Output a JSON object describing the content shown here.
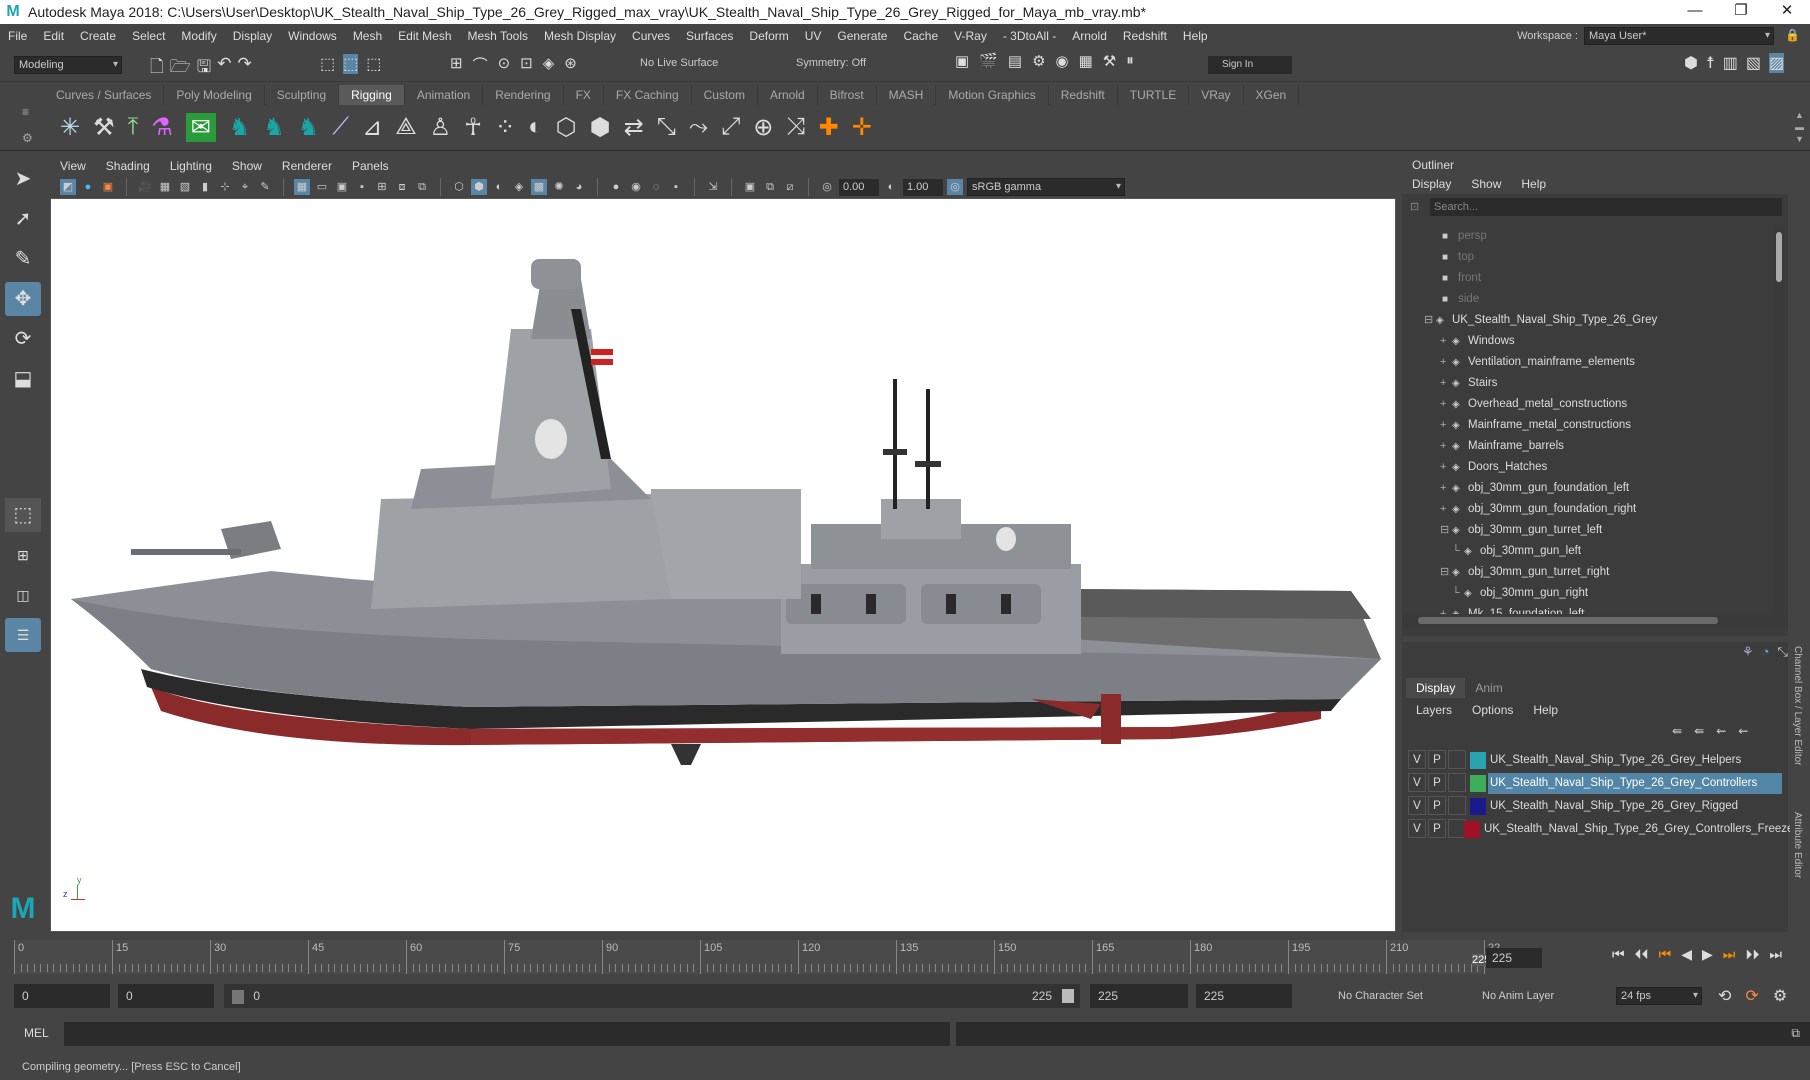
{
  "title": "Autodesk Maya 2018: C:\\Users\\User\\Desktop\\UK_Stealth_Naval_Ship_Type_26_Grey_Rigged_max_vray\\UK_Stealth_Naval_Ship_Type_26_Grey_Rigged_for_Maya_mb_vray.mb*",
  "menus": [
    "File",
    "Edit",
    "Create",
    "Select",
    "Modify",
    "Display",
    "Windows",
    "Mesh",
    "Edit Mesh",
    "Mesh Tools",
    "Mesh Display",
    "Curves",
    "Surfaces",
    "Deform",
    "UV",
    "Generate",
    "Cache",
    "V-Ray",
    "- 3DtoAll -",
    "Arnold",
    "Redshift",
    "Help"
  ],
  "workspace": {
    "label": "Workspace :",
    "value": "Maya User*"
  },
  "status": {
    "mode": "Modeling",
    "live_surface": "No Live Surface",
    "symmetry": "Symmetry: Off",
    "sign_in": "Sign In"
  },
  "shelf_tabs": [
    "Curves / Surfaces",
    "Poly Modeling",
    "Sculpting",
    "Rigging",
    "Animation",
    "Rendering",
    "FX",
    "FX Caching",
    "Custom",
    "Arnold",
    "Bifrost",
    "MASH",
    "Motion Graphics",
    "Redshift",
    "TURTLE",
    "VRay",
    "XGen"
  ],
  "active_shelf": "Rigging",
  "viewport_menu": [
    "View",
    "Shading",
    "Lighting",
    "Show",
    "Renderer",
    "Panels"
  ],
  "viewport_fields": {
    "exposure": "0.00",
    "gamma": "1.00",
    "colorspace": "sRGB gamma"
  },
  "outliner": {
    "title": "Outliner",
    "menu": [
      "Display",
      "Show",
      "Help"
    ],
    "search_placeholder": "Search...",
    "cameras": [
      "persp",
      "top",
      "front",
      "side"
    ],
    "root": "UK_Stealth_Naval_Ship_Type_26_Grey",
    "children": [
      "Windows",
      "Ventilation_mainframe_elements",
      "Stairs",
      "Overhead_metal_constructions",
      "Mainframe_metal_constructions",
      "Mainframe_barrels",
      "Doors_Hatches",
      "obj_30mm_gun_foundation_left",
      "obj_30mm_gun_foundation_right",
      "obj_30mm_gun_turret_left",
      "obj_30mm_gun_left",
      "obj_30mm_gun_turret_right",
      "obj_30mm_gun_right",
      "Mk_15_foundation_left"
    ]
  },
  "layers": {
    "tabs": [
      "Display",
      "Anim"
    ],
    "menu": [
      "Layers",
      "Options",
      "Help"
    ],
    "rows": [
      {
        "v": "V",
        "p": "P",
        "name": "UK_Stealth_Naval_Ship_Type_26_Grey_Helpers",
        "color": "#2aa3b0"
      },
      {
        "v": "V",
        "p": "P",
        "name": "UK_Stealth_Naval_Ship_Type_26_Grey_Controllers",
        "color": "#3fae5a"
      },
      {
        "v": "V",
        "p": "P",
        "name": "UK_Stealth_Naval_Ship_Type_26_Grey_Rigged",
        "color": "#1a1a8a"
      },
      {
        "v": "V",
        "p": "P",
        "name": "UK_Stealth_Naval_Ship_Type_26_Grey_Controllers_Freeze",
        "color": "#a0102a"
      }
    ]
  },
  "side_tabs": [
    "Channel Box / Layer Editor",
    "Attribute Editor"
  ],
  "timeline": {
    "ticks": [
      "0",
      "15",
      "30",
      "45",
      "60",
      "75",
      "90",
      "105",
      "120",
      "135",
      "150",
      "165",
      "180",
      "195",
      "210",
      "22"
    ],
    "current": "225",
    "current_field": "225"
  },
  "range": {
    "start": "0",
    "start2": "0",
    "slider_start": "0",
    "slider_end": "225",
    "end": "225",
    "end2": "225",
    "char_set": "No Character Set",
    "anim_layer": "No Anim Layer",
    "fps": "24 fps"
  },
  "mel": {
    "label": "MEL"
  },
  "statusbar": "Compiling geometry... [Press ESC to Cancel]",
  "axis": {
    "y": "y",
    "z": "z"
  }
}
